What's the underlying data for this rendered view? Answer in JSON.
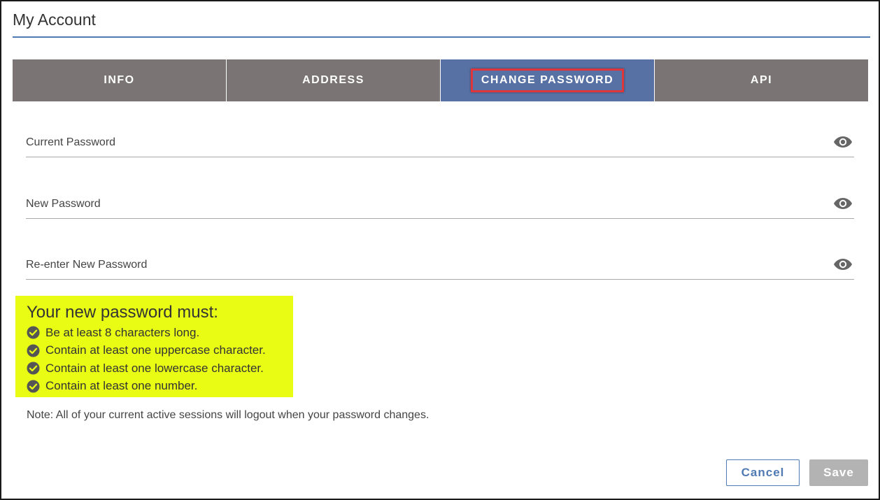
{
  "header": {
    "title": "My Account"
  },
  "tabs": [
    {
      "label": "INFO",
      "active": false
    },
    {
      "label": "ADDRESS",
      "active": false
    },
    {
      "label": "CHANGE PASSWORD",
      "active": true
    },
    {
      "label": "API",
      "active": false
    }
  ],
  "fields": {
    "current_password": {
      "label": "Current Password",
      "value": ""
    },
    "new_password": {
      "label": "New Password",
      "value": ""
    },
    "reenter_password": {
      "label": "Re-enter New Password",
      "value": ""
    }
  },
  "rules": {
    "title": "Your new password must:",
    "items": [
      "Be at least 8 characters long.",
      "Contain at least one uppercase character.",
      "Contain at least one lowercase character.",
      "Contain at least one number."
    ]
  },
  "note": "Note: All of your current active sessions will logout when your password changes.",
  "actions": {
    "cancel_label": "Cancel",
    "save_label": "Save"
  },
  "icons": {
    "visibility": "eye-icon",
    "rule_check": "check-circle-icon"
  },
  "colors": {
    "tab_bg": "#7a7574",
    "tab_active_bg": "#5871a4",
    "highlight_box": "#e0353b",
    "rules_bg": "#e8fc14",
    "accent": "#4f7ab3",
    "save_disabled": "#b3b3b3"
  }
}
